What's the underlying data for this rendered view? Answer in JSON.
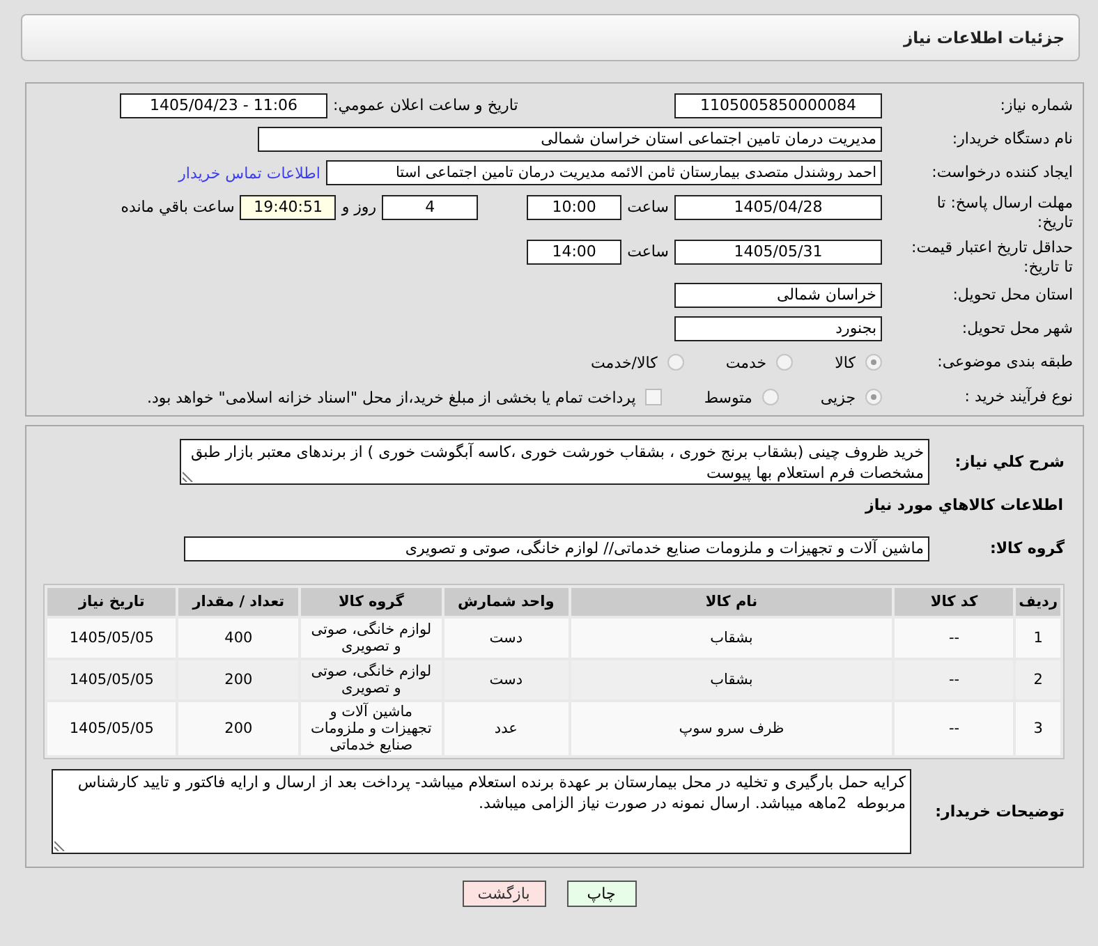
{
  "header": {
    "title": "جزئیات اطلاعات نیاز"
  },
  "details": {
    "need_number": {
      "label": "شماره نیاز:",
      "value": "1105005850000084"
    },
    "announce_datetime": {
      "label": "تاریخ و ساعت اعلان عمومي:",
      "value": "1405/04/23 - 11:06"
    },
    "buyer_org": {
      "label": "نام دستگاه خریدار:",
      "value": "مدیریت درمان تامین اجتماعی استان خراسان شمالی"
    },
    "requester": {
      "label": "ایجاد کننده درخواست:",
      "value": "احمد روشندل متصدی بیمارستان ثامن الائمه مدیریت درمان تامین اجتماعی استا",
      "contact_link": "اطلاعات تماس خریدار"
    },
    "response_deadline": {
      "label": "مهلت ارسال پاسخ: تا تاریخ:",
      "date": "1405/04/28",
      "time_label": "ساعت",
      "time": "10:00",
      "days": "4",
      "days_label": "روز و",
      "remaining": "19:40:51",
      "remaining_label": "ساعت باقي مانده"
    },
    "price_validity": {
      "label": "حداقل تاریخ اعتبار قیمت: تا تاریخ:",
      "date": "1405/05/31",
      "time_label": "ساعت",
      "time": "14:00"
    },
    "delivery_province": {
      "label": "استان محل تحویل:",
      "value": "خراسان شمالی"
    },
    "delivery_city": {
      "label": "شهر محل تحویل:",
      "value": "بجنورد"
    },
    "category": {
      "label": "طبقه بندی موضوعی:",
      "disabled": true,
      "options": [
        {
          "label": "کالا",
          "selected": true
        },
        {
          "label": "خدمت",
          "selected": false
        },
        {
          "label": "کالا/خدمت",
          "selected": false
        }
      ]
    },
    "purchase_type": {
      "label": "نوع فرآیند خرید :",
      "disabled": true,
      "options": [
        {
          "label": "جزیی",
          "selected": true
        },
        {
          "label": "متوسط",
          "selected": false
        }
      ],
      "treasury_option": {
        "label": "پرداخت تمام یا بخشی از مبلغ خرید،از محل \"اسناد خزانه اسلامی\" خواهد بود.",
        "checked": false
      }
    }
  },
  "need_summary": {
    "label": "شرح کلي نیاز:",
    "value": "خرید ظروف چینی (بشقاب برنج خوری ، بشقاب خورشت خوری ،کاسه آبگوشت خوری ) از برندهای معتبر بازار طبق مشخصات فرم استعلام بها پیوست"
  },
  "goods_section": {
    "title": "اطلاعات کالاهاي مورد نیاز"
  },
  "goods_group": {
    "label": "گروه کالا:",
    "value": "ماشین آلات و تجهیزات و ملزومات صنایع خدماتی// لوازم خانگی، صوتی و تصویری"
  },
  "items_table": {
    "columns": [
      "ردیف",
      "کد کالا",
      "نام کالا",
      "واحد شمارش",
      "گروه کالا",
      "تعداد / مقدار",
      "تاریخ نیاز"
    ],
    "rows": [
      {
        "cells": [
          "1",
          "--",
          "بشقاب",
          "دست",
          "لوازم خانگی، صوتی و تصویری",
          "400",
          "1405/05/05"
        ]
      },
      {
        "cells": [
          "2",
          "--",
          "بشقاب",
          "دست",
          "لوازم خانگی، صوتی و تصویری",
          "200",
          "1405/05/05"
        ]
      },
      {
        "cells": [
          "3",
          "--",
          "ظرف سرو سوپ",
          "عدد",
          "ماشین آلات و تجهیزات و ملزومات صنایع خدماتی",
          "200",
          "1405/05/05"
        ]
      }
    ]
  },
  "buyer_notes": {
    "label": "توضیحات خریدار:",
    "value": "کرایه حمل بارگیری و تخلیه در محل بیمارستان بر عهدة برنده استعلام میباشد- پرداخت بعد از ارسال و ارایه فاکتور و تایید کارشناس مربوطه  2ماهه میباشد. ارسال نمونه در صورت نیاز الزامی میباشد."
  },
  "buttons": [
    {
      "label": "چاپ",
      "kind": "print"
    },
    {
      "label": "بازگشت",
      "kind": "back"
    }
  ]
}
